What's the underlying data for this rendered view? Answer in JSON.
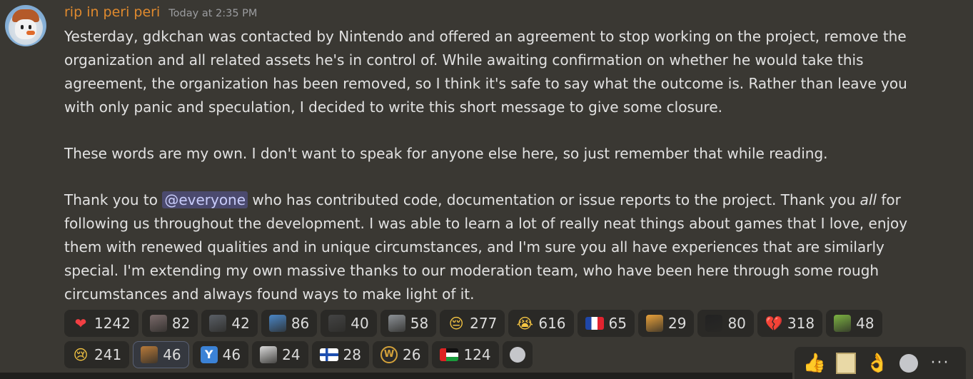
{
  "message": {
    "username": "rip in peri peri",
    "timestamp": "Today at 2:35 PM",
    "paragraph1": "Yesterday, gdkchan was contacted by Nintendo and offered an agreement to stop working on the project, remove the organization and all related assets he's in control of. While awaiting confirmation on whether he would take this agreement, the organization has been removed, so I think it's safe to say what the outcome is. Rather than leave you with only panic and speculation, I decided to write this short message to give some closure.",
    "paragraph2": "These words are my own. I don't want to speak for anyone else here, so just remember that while reading.",
    "paragraph3_pre": "Thank you to ",
    "mention": "@everyone",
    "paragraph3_mid": " who has contributed code, documentation or issue reports to the project. Thank you ",
    "paragraph3_em": "all",
    "paragraph3_post": " for following us throughout the development. I was able to learn a lot of really neat things about games that I love, enjoy them with renewed qualities and in unique circumstances, and I'm sure you all have experiences that are similarly special. I'm extending my own massive thanks to our moderation team, who have been here through some rough circumstances and always found ways to make light of it."
  },
  "reactions": [
    {
      "icon": "heart-icon",
      "glyph": "❤",
      "color": "#f23f43",
      "count": "1242"
    },
    {
      "icon": "custom-emoji-person-icon",
      "glyph": "",
      "color": "#7a6a6a",
      "count": "82"
    },
    {
      "icon": "custom-emoji-crowd-icon",
      "glyph": "",
      "color": "#5a5f66",
      "count": "42"
    },
    {
      "icon": "custom-emoji-blue-icon",
      "glyph": "",
      "color": "#4a86c6",
      "count": "86"
    },
    {
      "icon": "custom-emoji-dark-icon",
      "glyph": "",
      "color": "#444444",
      "count": "40"
    },
    {
      "icon": "custom-emoji-moai-icon",
      "glyph": "",
      "color": "#8d9297",
      "count": "58"
    },
    {
      "icon": "relieved-face-icon",
      "glyph": "😔",
      "color": "#f5c542",
      "count": "277"
    },
    {
      "icon": "crying-face-icon",
      "glyph": "😭",
      "color": "#f5c542",
      "count": "616"
    },
    {
      "icon": "flag-france-icon",
      "glyph": "",
      "color": "#ffffff",
      "count": "65"
    },
    {
      "icon": "custom-emoji-party-icon",
      "glyph": "",
      "color": "#e9a23b",
      "count": "29"
    },
    {
      "icon": "custom-emoji-hooded-icon",
      "glyph": "",
      "color": "#222222",
      "count": "80"
    },
    {
      "icon": "broken-heart-icon",
      "glyph": "💔",
      "color": "#f23f43",
      "count": "318"
    },
    {
      "icon": "custom-emoji-bottle-icon",
      "glyph": "",
      "color": "#7cb342",
      "count": "48"
    },
    {
      "icon": "sad-face-icon",
      "glyph": "😢",
      "color": "#f5c542",
      "count": "241"
    },
    {
      "icon": "custom-emoji-cat-icon",
      "glyph": "",
      "color": "#b87a3a",
      "count": "46",
      "me": true
    },
    {
      "icon": "letter-y-icon",
      "glyph": "Y",
      "color": "#3b82d6",
      "count": "46"
    },
    {
      "icon": "custom-emoji-santa-icon",
      "glyph": "",
      "color": "#d9d9d9",
      "count": "24"
    },
    {
      "icon": "flag-finland-icon",
      "glyph": "",
      "color": "#ffffff",
      "count": "28"
    },
    {
      "icon": "custom-emoji-w-badge-icon",
      "glyph": "W",
      "color": "#d4a23a",
      "count": "26"
    },
    {
      "icon": "flag-palestine-icon",
      "glyph": "",
      "color": "#ffffff",
      "count": "124"
    }
  ],
  "toolbar": {
    "thumbs_up": "👍",
    "ok_hand": "👌",
    "more": "···"
  }
}
